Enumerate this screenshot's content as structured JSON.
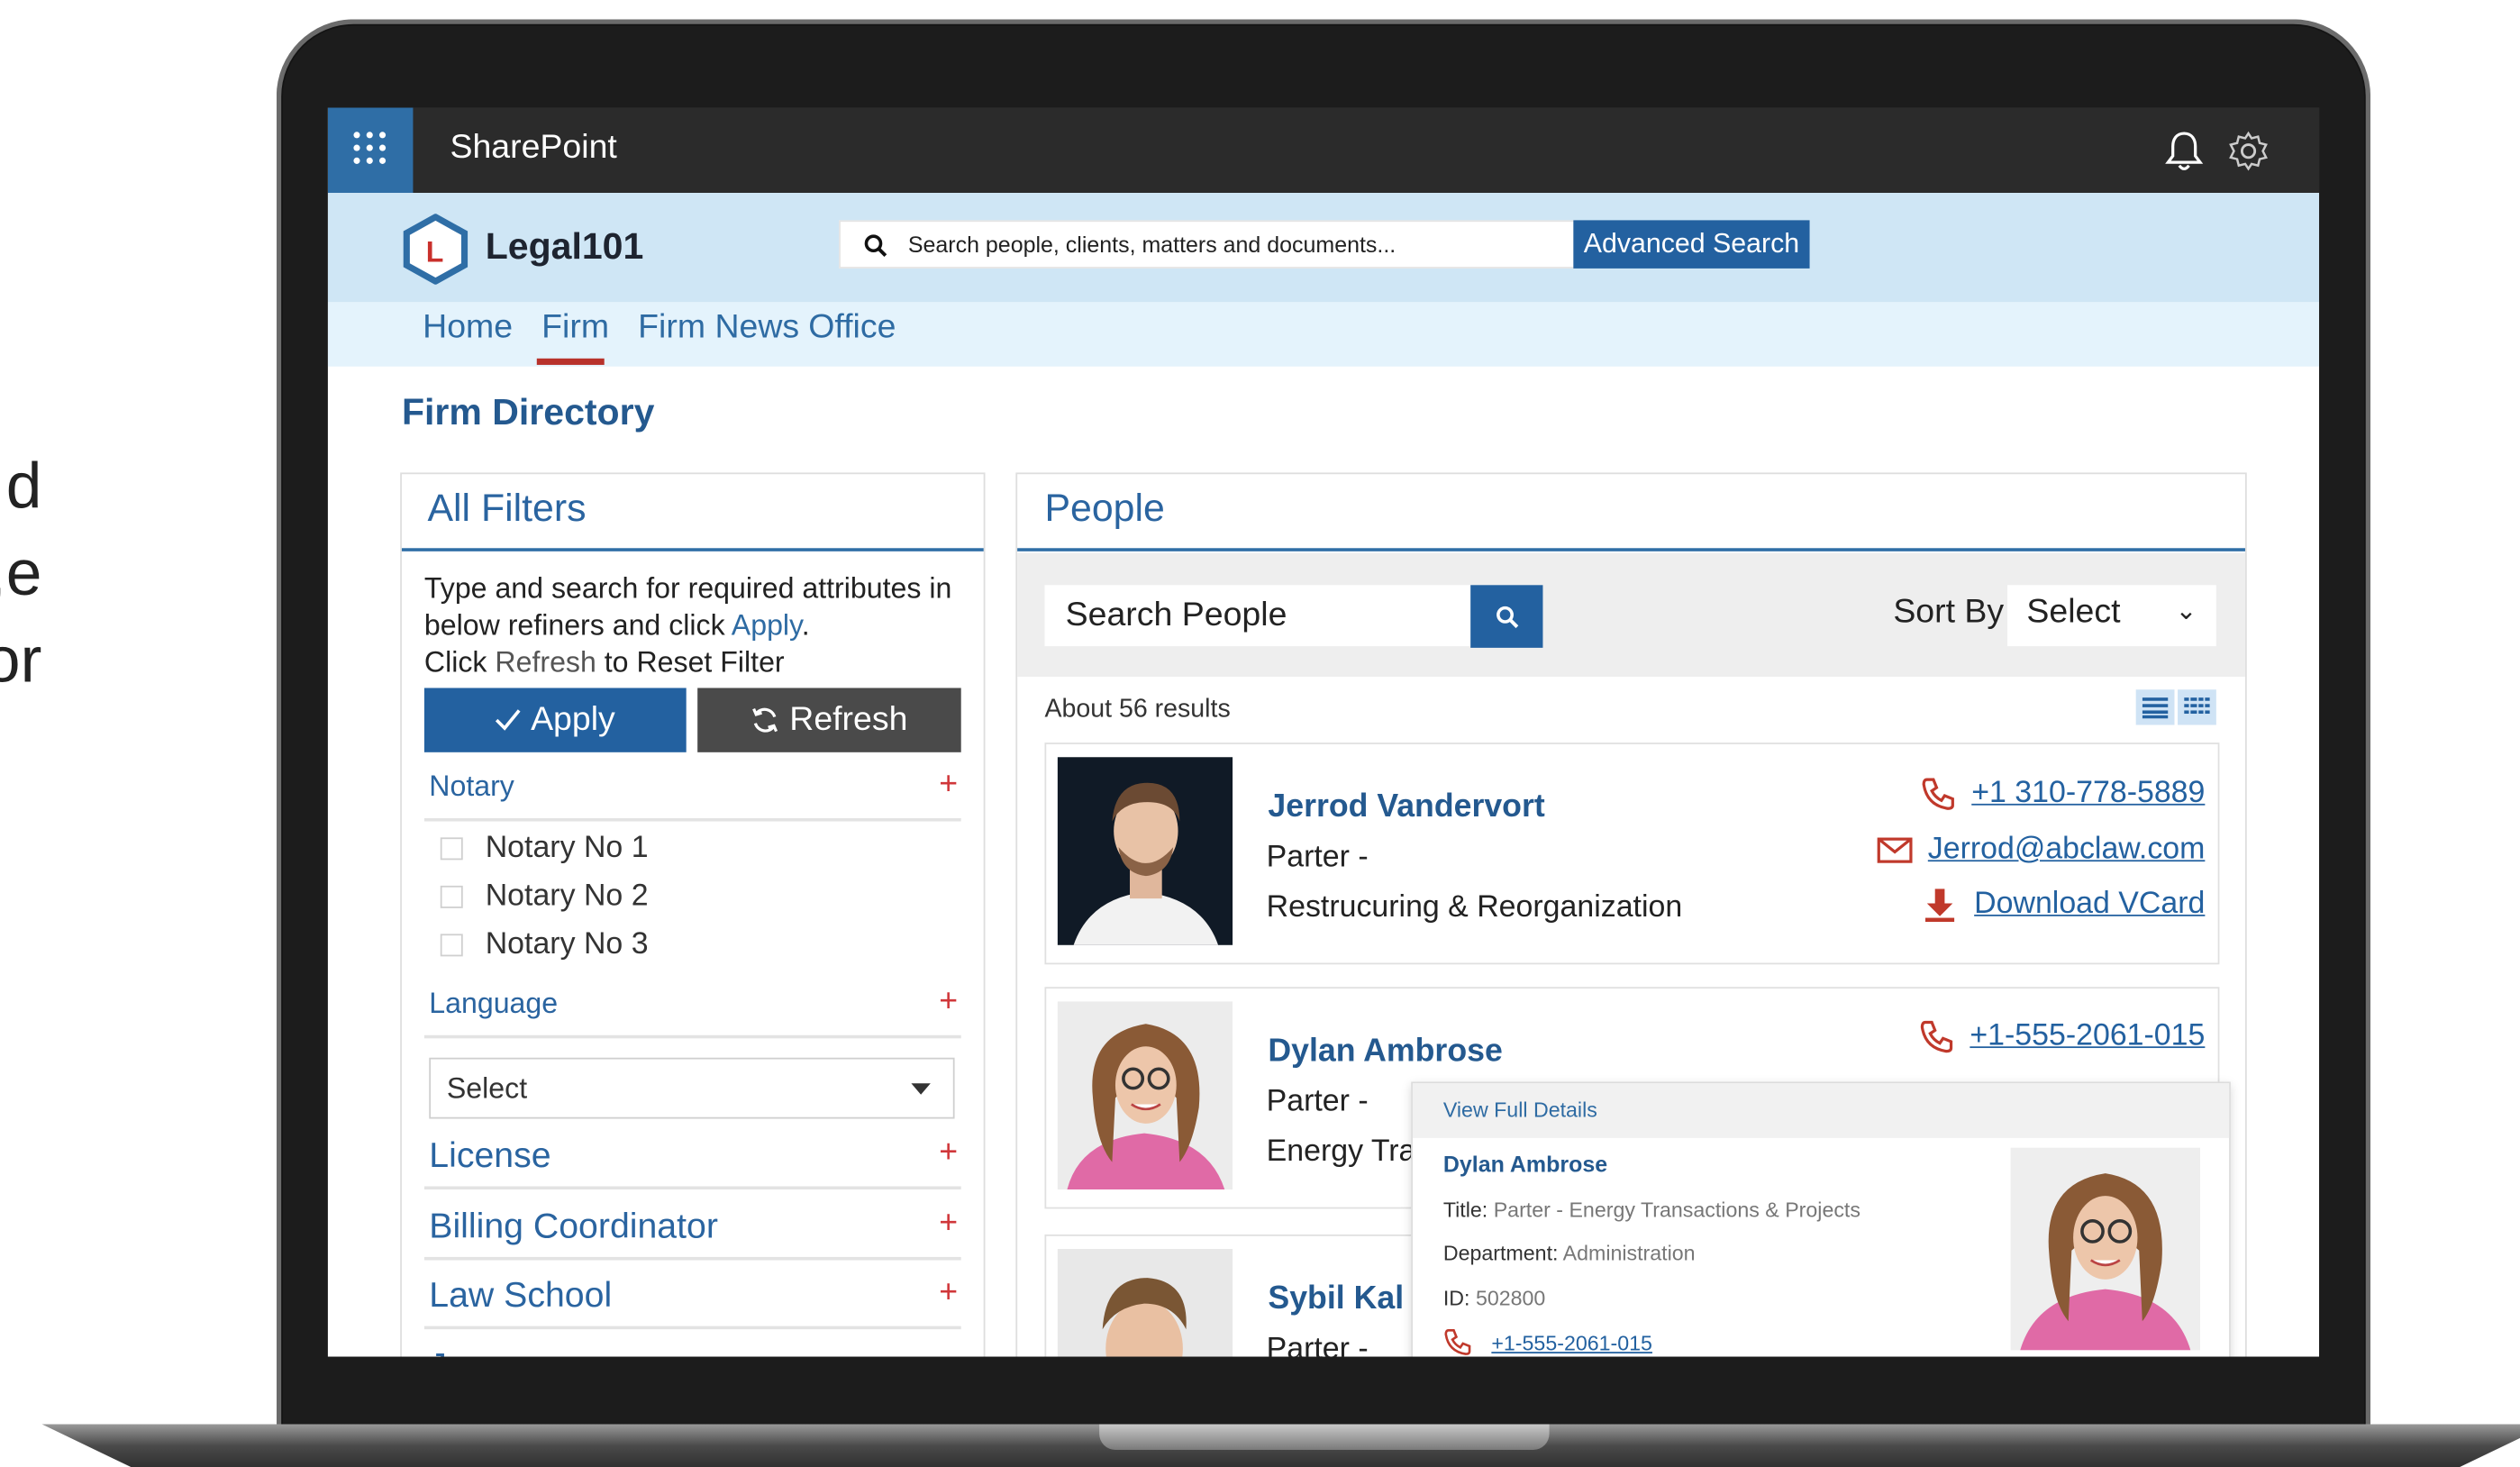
{
  "side_text": [
    "d",
    "e,",
    "or"
  ],
  "suitebar": {
    "title": "SharePoint"
  },
  "header": {
    "logo_text": "Legal101",
    "logo_letter": "L",
    "search_placeholder": "Search people, clients, matters and documents...",
    "advanced_search": "Advanced Search"
  },
  "nav": {
    "items": [
      "Home",
      "Firm",
      "Firm News",
      "Office"
    ],
    "active": "Firm"
  },
  "page_title": "Firm Directory",
  "filters": {
    "title": "All Filters",
    "intro_a": "Type and search for required attributes in below refiners and click ",
    "intro_apply": "Apply",
    "intro_dot": ".",
    "intro_click": "Click ",
    "intro_refresh": "Refresh",
    "intro_reset": " to Reset Filter",
    "apply_label": "Apply",
    "refresh_label": "Refresh",
    "refiners": [
      "Notary",
      "Language",
      "License",
      "Billing Coordinator",
      "Law School",
      "Ju"
    ],
    "notary_options": [
      "Notary No 1",
      "Notary No 2",
      "Notary No 3"
    ],
    "language_select": "Select",
    "plus": "+"
  },
  "people": {
    "title": "People",
    "search_placeholder": "Search People",
    "sort_label": "Sort By",
    "sort_value": "Select",
    "sort_chevron": "⌄",
    "results": "About 56 results",
    "cards": [
      {
        "name": "Jerrod Vandervort",
        "title_line": "Parter -",
        "dept_line": "Restrucuring & Reorganization",
        "phone": "+1 310-778-5889",
        "email": "Jerrod@abclaw.com",
        "vcard": "Download VCard"
      },
      {
        "name": "Dylan Ambrose",
        "title_line": "Parter -",
        "dept_line": "Energy Tran",
        "phone": "+1-555-2061-015"
      },
      {
        "name": "Sybil Kal",
        "title_line": "Parter -"
      }
    ]
  },
  "popup": {
    "view_full": "View Full Details",
    "name": "Dylan Ambrose",
    "title_label": "Title: ",
    "title_value": "Parter - Energy Transactions & Projects",
    "dept_label": "Department: ",
    "dept_value": "Administration",
    "id_label": "ID: ",
    "id_value": "502800",
    "phone": "+1-555-2061-015"
  },
  "colors": {
    "brand_blue": "#2361a0",
    "suite_bar": "#2b2b2b",
    "header_bg": "#cfe6f5",
    "accent_red": "#b8322b"
  }
}
